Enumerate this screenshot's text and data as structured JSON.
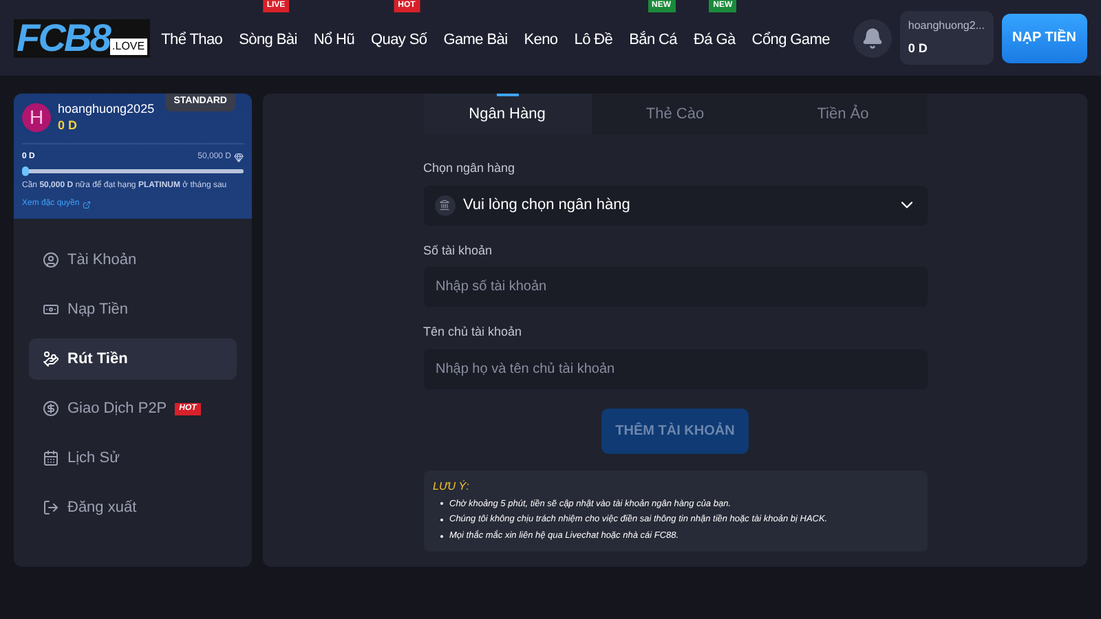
{
  "header": {
    "logo": {
      "main": "FCB8",
      "sub": ".LOVE"
    },
    "nav": [
      {
        "label": "Thể Thao"
      },
      {
        "label": "Sòng Bài",
        "badge": {
          "text": "LIVE",
          "color": "#d7202a"
        }
      },
      {
        "label": "Nổ Hũ"
      },
      {
        "label": "Quay Số",
        "badge": {
          "text": "HOT",
          "color": "#d7202a"
        }
      },
      {
        "label": "Game Bài"
      },
      {
        "label": "Keno"
      },
      {
        "label": "Lô Đề"
      },
      {
        "label": "Bắn Cá",
        "badge": {
          "text": "NEW",
          "color": "#1a8a3a"
        }
      },
      {
        "label": "Đá Gà",
        "badge": {
          "text": "NEW",
          "color": "#1a8a3a"
        }
      },
      {
        "label": "Cổng Game"
      }
    ],
    "account": {
      "username": "hoanghuong2...",
      "balance": "0 D"
    },
    "deposit_button": "NẠP TIỀN"
  },
  "profile": {
    "avatar": "H",
    "username": "hoanghuong2025",
    "balance": "0 D",
    "tier": "STANDARD",
    "progress_start": "0 D",
    "progress_end": "50,000 D",
    "level": 0,
    "note": "Cần **50,000 D** nữa để đạt hạng **PLATINUM** ở tháng sau",
    "link": "Xem đặc quyền"
  },
  "sidebar": {
    "items": [
      {
        "label": "Tài Khoản",
        "selected": false
      },
      {
        "label": "Nạp Tiền",
        "selected": false
      },
      {
        "label": "Rút Tiền",
        "selected": true
      },
      {
        "label": "Giao Dịch P2P",
        "selected": false,
        "badge": "HOT"
      },
      {
        "label": "Lịch Sử",
        "selected": false
      },
      {
        "label": "Đăng xuất",
        "selected": false
      }
    ]
  },
  "tabs": [
    {
      "label": "Ngân Hàng",
      "selected": true
    },
    {
      "label": "Thẻ Cào",
      "selected": false
    },
    {
      "label": "Tiền Ảo",
      "selected": false
    }
  ],
  "form": {
    "fields": [
      {
        "kind": "select",
        "label": "Chọn ngân hàng",
        "value": "Vui lòng chọn ngân hàng"
      },
      {
        "kind": "input",
        "label": "Số tài khoản",
        "placeholder": "Nhập số tài khoản"
      },
      {
        "kind": "input",
        "label": "Tên chủ tài khoản",
        "placeholder": "Nhập họ và tên chủ tài khoản"
      }
    ],
    "submit": {
      "label": "THÊM TÀI KHOẢN",
      "disabled": true
    }
  },
  "notice": {
    "title": "LƯU Ý:",
    "items": [
      "Chờ khoảng 5 phút, tiền sẽ cập nhật vào tài khoản ngân hàng của bạn.",
      "Chúng tôi không chịu trách nhiệm cho việc điền sai thông tin nhận tiền hoặc tài khoản bị HACK.",
      "Mọi thắc mắc xin liên hệ qua Livechat hoặc nhà cái FC88."
    ]
  }
}
